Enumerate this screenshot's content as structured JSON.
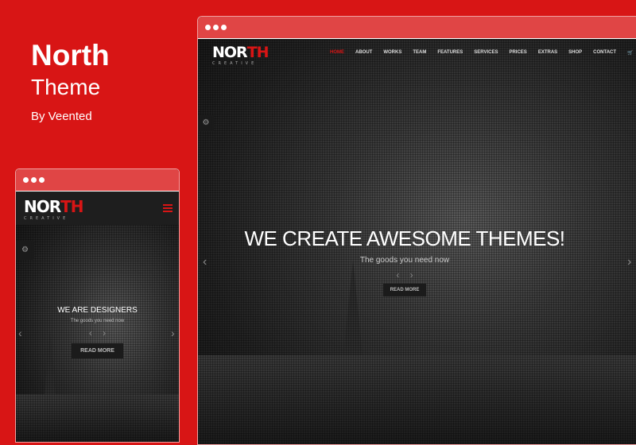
{
  "brand": {
    "title": "North",
    "subtitle": "Theme",
    "author": "By Veented"
  },
  "logo": {
    "main": "NOR",
    "accent": "TH",
    "tagline": "CREATIVE"
  },
  "desktop": {
    "nav": [
      "HOME",
      "ABOUT",
      "WORKS",
      "TEAM",
      "FEATURES",
      "SERVICES",
      "PRICES",
      "EXTRAS",
      "SHOP",
      "CONTACT"
    ],
    "headline": "WE CREATE AWESOME THEMES!",
    "subline": "The goods you need now",
    "button": "READ MORE"
  },
  "mobile": {
    "headline": "WE ARE DESIGNERS",
    "subline": "The goods you need now",
    "button": "READ MORE"
  },
  "colors": {
    "brand": "#d81515",
    "bar": "#e04545"
  }
}
